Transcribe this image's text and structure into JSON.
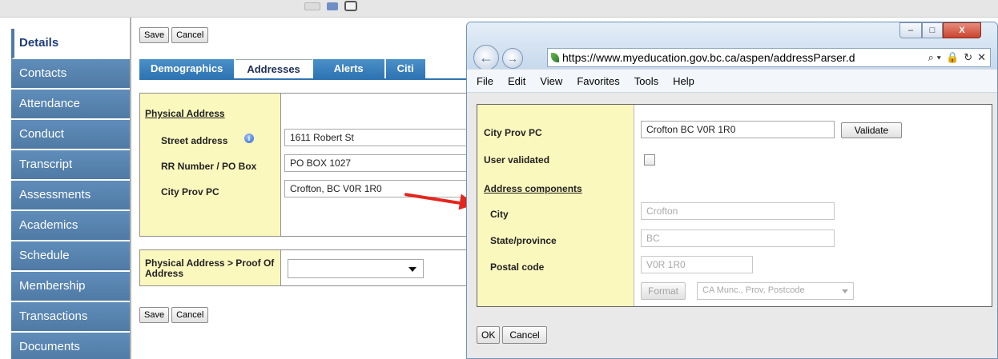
{
  "nav": {
    "items": [
      {
        "label": "Details",
        "active": true
      },
      {
        "label": "Contacts"
      },
      {
        "label": "Attendance"
      },
      {
        "label": "Conduct"
      },
      {
        "label": "Transcript"
      },
      {
        "label": "Assessments"
      },
      {
        "label": "Academics"
      },
      {
        "label": "Schedule"
      },
      {
        "label": "Membership"
      },
      {
        "label": "Transactions"
      },
      {
        "label": "Documents"
      }
    ]
  },
  "toolbar": {
    "save_label": "Save",
    "cancel_label": "Cancel"
  },
  "tabs": [
    {
      "label": "Demographics"
    },
    {
      "label": "Addresses",
      "active": true
    },
    {
      "label": "Alerts"
    },
    {
      "label": "Citi"
    }
  ],
  "address": {
    "section_title": "Physical Address",
    "street_label": "Street address",
    "street_value": "1611 Robert St",
    "rr_label": "RR Number / PO Box",
    "rr_value": "PO BOX 1027",
    "city_label": "City Prov PC",
    "city_value": "Crofton, BC V0R 1R0"
  },
  "proof": {
    "label": "Physical Address > Proof Of Address"
  },
  "popup": {
    "window_buttons": {
      "minimize": "–",
      "maximize": "□",
      "close": "X"
    },
    "url": "https://www.myeducation.gov.bc.ca/aspen/addressParser.d",
    "address_controls": {
      "search": "⌕ ▾",
      "lock": "🔒",
      "refresh": "↻",
      "close": "✕"
    },
    "menu": [
      "File",
      "Edit",
      "View",
      "Favorites",
      "Tools",
      "Help"
    ],
    "city_prov_label": "City Prov PC",
    "city_prov_value": "Crofton BC  V0R 1R0",
    "validate_label": "Validate",
    "user_validated_label": "User validated",
    "components_title": "Address components",
    "city_label": "City",
    "city_value": "Crofton",
    "state_label": "State/province",
    "state_value": "BC",
    "postal_label": "Postal code",
    "postal_value": "V0R 1R0",
    "format_label": "Format",
    "format_select": "CA Munc., Prov, Postcode",
    "ok_label": "OK",
    "cancel_label": "Cancel"
  }
}
